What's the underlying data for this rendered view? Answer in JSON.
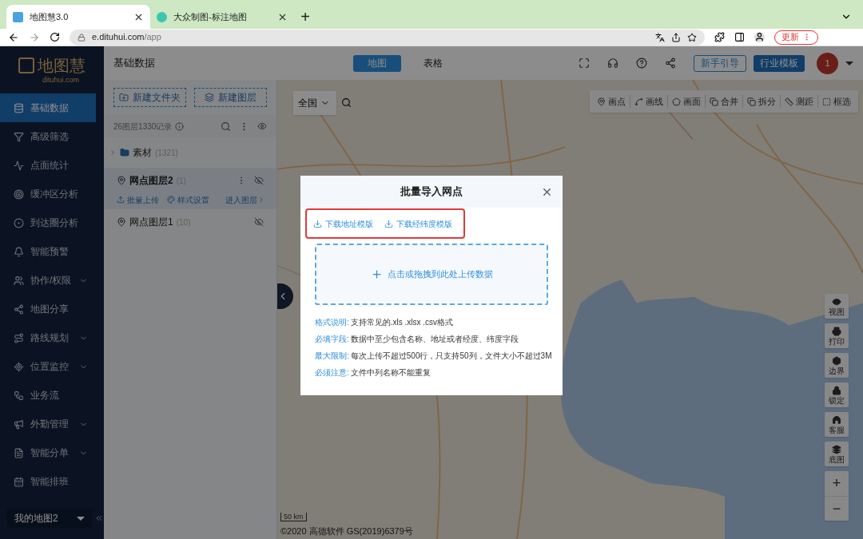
{
  "browser": {
    "tabs": [
      {
        "title": "地图慧3.0",
        "selected": true
      },
      {
        "title": "大众制图-标注地图",
        "selected": false
      }
    ],
    "new_tab": "+",
    "url_host": "e.dituhui.com",
    "url_path": "/app",
    "update_button": "更新"
  },
  "logo": {
    "name": "地图慧",
    "domain": "dituhui.com"
  },
  "sidebar": {
    "items": [
      {
        "label": "基础数据",
        "selected": true,
        "has_submenu": false
      },
      {
        "label": "高级筛选",
        "selected": false,
        "has_submenu": false
      },
      {
        "label": "点面统计",
        "selected": false,
        "has_submenu": false
      },
      {
        "label": "缓冲区分析",
        "selected": false,
        "has_submenu": false
      },
      {
        "label": "到达圈分析",
        "selected": false,
        "has_submenu": false
      },
      {
        "label": "智能预警",
        "selected": false,
        "has_submenu": false
      },
      {
        "label": "协作/权限",
        "selected": false,
        "has_submenu": true
      },
      {
        "label": "地图分享",
        "selected": false,
        "has_submenu": false
      },
      {
        "label": "路线规划",
        "selected": false,
        "has_submenu": true
      },
      {
        "label": "位置监控",
        "selected": false,
        "has_submenu": true
      },
      {
        "label": "业务流",
        "selected": false,
        "has_submenu": false
      },
      {
        "label": "外勤管理",
        "selected": false,
        "has_submenu": true
      },
      {
        "label": "智能分单",
        "selected": false,
        "has_submenu": true
      },
      {
        "label": "智能排班",
        "selected": false,
        "has_submenu": false
      }
    ],
    "map_selector": "我的地图2"
  },
  "header": {
    "title": "基础数据",
    "view_tabs": [
      {
        "label": "地图",
        "selected": true
      },
      {
        "label": "表格",
        "selected": false
      }
    ],
    "guide_button": "新手引导",
    "template_button": "行业模板",
    "avatar": "1"
  },
  "layers": {
    "buttons": [
      "新建文件夹",
      "新建图层"
    ],
    "summary": "26图层1330记录",
    "items": [
      {
        "kind": "folder",
        "name": "素材",
        "count": "(1321)",
        "selected": false
      },
      {
        "kind": "layer",
        "name": "网点图层2",
        "count": "(1)",
        "selected": true,
        "actions": [
          "批量上传",
          "样式设置"
        ],
        "enter": "进入图层"
      },
      {
        "kind": "layer",
        "name": "网点图层1",
        "count": "(10)",
        "selected": false
      }
    ]
  },
  "map": {
    "region": "全国",
    "tools": [
      "画点",
      "画线",
      "画面",
      "合并",
      "拆分",
      "测距",
      "框选"
    ],
    "side_tools": [
      "视图",
      "打印",
      "边界",
      "锁定",
      "客服",
      "底图"
    ],
    "zoom_in": "+",
    "zoom_out": "−",
    "scale": "50 km",
    "copyright": "©2020 高德软件 GS(2019)6379号"
  },
  "modal": {
    "title": "批量导入网点",
    "downloads": [
      "下载地址模版",
      "下载经纬度模版"
    ],
    "upload": "点击或拖拽到此处上传数据",
    "notes": [
      {
        "label": "格式说明:",
        "text": "支持常见的.xls .xlsx .csv格式"
      },
      {
        "label": "必填字段:",
        "text": "数据中至少包含名称、地址或者经度、纬度字段"
      },
      {
        "label": "最大限制:",
        "text": "每次上传不超过500行，只支持50列，文件大小不超过3M"
      },
      {
        "label": "必须注意:",
        "text": "文件中列名称不能重复"
      }
    ]
  }
}
